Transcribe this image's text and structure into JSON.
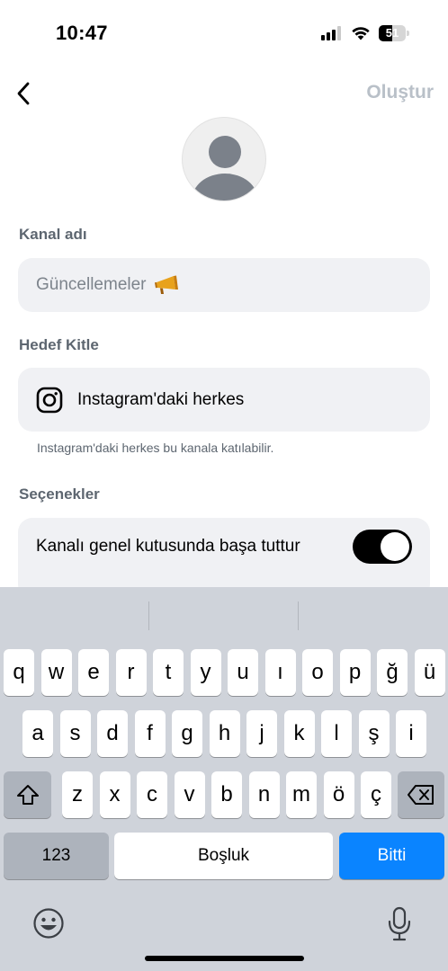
{
  "status_bar": {
    "time": "10:47",
    "battery": "51",
    "battery_level": 0.51
  },
  "header": {
    "create_label": "Oluştur"
  },
  "form": {
    "channel_name_label": "Kanal adı",
    "channel_name_placeholder": "Güncellemeler",
    "audience_label": "Hedef Kitle",
    "audience_value": "Instagram'daki herkes",
    "audience_helper": "Instagram'daki herkes bu kanala katılabilir.",
    "options_label": "Seçenekler",
    "pin_option_label": "Kanalı genel kutusunda başa tuttur",
    "pin_option_enabled": true
  },
  "keyboard": {
    "row1": [
      "q",
      "w",
      "e",
      "r",
      "t",
      "y",
      "u",
      "ı",
      "o",
      "p",
      "ğ",
      "ü"
    ],
    "row2": [
      "a",
      "s",
      "d",
      "f",
      "g",
      "h",
      "j",
      "k",
      "l",
      "ş",
      "i"
    ],
    "row3": [
      "z",
      "x",
      "c",
      "v",
      "b",
      "n",
      "m",
      "ö",
      "ç"
    ],
    "numbers_label": "123",
    "space_label": "Boşluk",
    "done_label": "Bitti"
  },
  "colors": {
    "accent": "#0a84ff",
    "field_bg": "#f0f1f4",
    "keyboard_bg": "#cfd3da",
    "disabled_text": "#b9c0c8"
  },
  "icons": {
    "back": "chevron-left-icon",
    "avatar": "person-icon",
    "instagram": "instagram-icon",
    "megaphone": "megaphone-icon",
    "shift": "shift-icon",
    "backspace": "backspace-icon",
    "emoji": "emoji-icon",
    "mic": "microphone-icon"
  }
}
